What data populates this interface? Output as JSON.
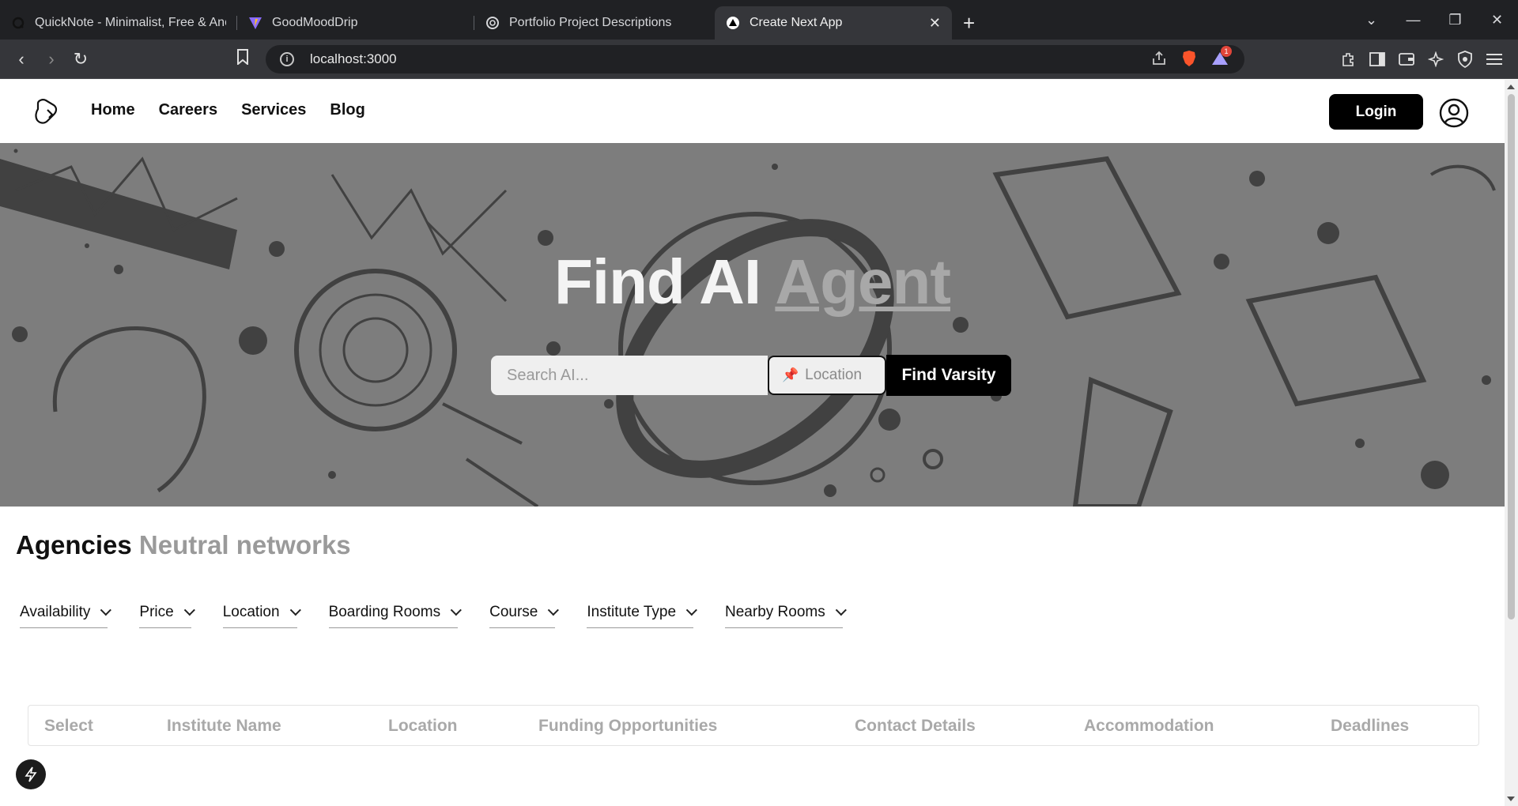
{
  "browser": {
    "tabs": [
      {
        "title": "QuickNote - Minimalist, Free & Anonymous",
        "icon": "quicknote-icon"
      },
      {
        "title": "GoodMoodDrip",
        "icon": "vite-icon"
      },
      {
        "title": "Portfolio Project Descriptions",
        "icon": "openai-icon"
      },
      {
        "title": "Create Next App",
        "icon": "nextjs-icon",
        "active": true
      }
    ],
    "url": "localhost:3000",
    "notification_count": "1"
  },
  "nav": {
    "links": [
      "Home",
      "Careers",
      "Services",
      "Blog"
    ],
    "login_label": "Login"
  },
  "hero": {
    "title_part1": "Find AI",
    "title_part2": "Agent",
    "search_placeholder": "Search AI...",
    "location_label": "Location",
    "find_button": "Find Varsity"
  },
  "agencies": {
    "title": "Agencies",
    "subtitle": "Neutral networks",
    "filters": [
      "Availability",
      "Price",
      "Location",
      "Boarding Rooms",
      "Course",
      "Institute Type",
      "Nearby Rooms"
    ],
    "columns": [
      "Select",
      "Institute Name",
      "Location",
      "Funding Opportunities",
      "Contact Details",
      "Accommodation",
      "Deadlines"
    ]
  }
}
